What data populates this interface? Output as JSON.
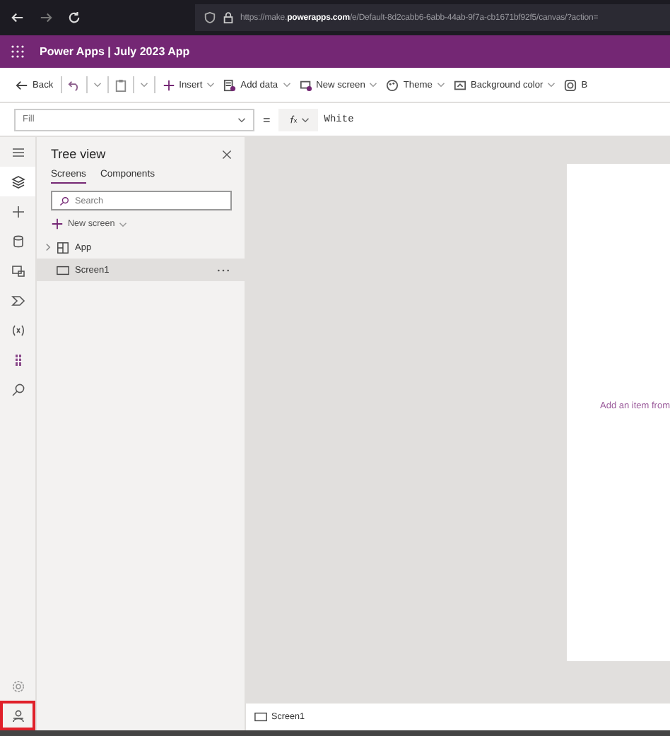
{
  "browser": {
    "url": "https://make.**powerapps.com**/e/Default-8d2cabb6-6abb-44ab-9f7a-cb1671bf92f5/canvas/?action="
  },
  "app_header": {
    "title": "Power Apps | July 2023 App"
  },
  "toolbar": [
    {
      "kind": "back",
      "label": "Back"
    },
    {
      "kind": "undo"
    },
    {
      "kind": "paste"
    },
    {
      "kind": "insert",
      "label": "Insert"
    },
    {
      "kind": "data",
      "label": "Add data"
    },
    {
      "kind": "screen",
      "label": "New screen"
    },
    {
      "kind": "theme",
      "label": "Theme"
    },
    {
      "kind": "background",
      "label": "Background color"
    },
    {
      "kind": "cut",
      "label": "B"
    }
  ],
  "formula_bar": {
    "property": "Fill",
    "equals": "=",
    "formula": "White"
  },
  "rail": {
    "top": [
      {
        "kind": "menu",
        "selected": false
      },
      {
        "kind": "layers",
        "selected": true
      },
      {
        "kind": "insert",
        "selected": false
      },
      {
        "kind": "data",
        "selected": false
      },
      {
        "kind": "media",
        "selected": false
      },
      {
        "kind": "flow",
        "selected": false
      },
      {
        "kind": "variables",
        "selected": false
      },
      {
        "kind": "bars",
        "selected": false
      },
      {
        "kind": "search",
        "selected": false
      }
    ],
    "bottom": [
      {
        "kind": "settings",
        "selected": false,
        "highlighted": false
      },
      {
        "kind": "agent",
        "selected": false,
        "highlighted": true
      }
    ]
  },
  "tree_view": {
    "title": "Tree view",
    "tabs": [
      {
        "label": "Screens",
        "selected": true
      },
      {
        "label": "Components",
        "selected": false
      }
    ],
    "search": {
      "placeholder": "Search"
    },
    "new_screen": "New screen",
    "items": [
      {
        "kind": "app",
        "label": "App",
        "selected": false,
        "expanded": false
      },
      {
        "kind": "screen",
        "label": "Screen1",
        "selected": true
      }
    ]
  },
  "canvas": {
    "hint": "Add an item from"
  },
  "status_bar": {
    "screen": "Screen1"
  }
}
